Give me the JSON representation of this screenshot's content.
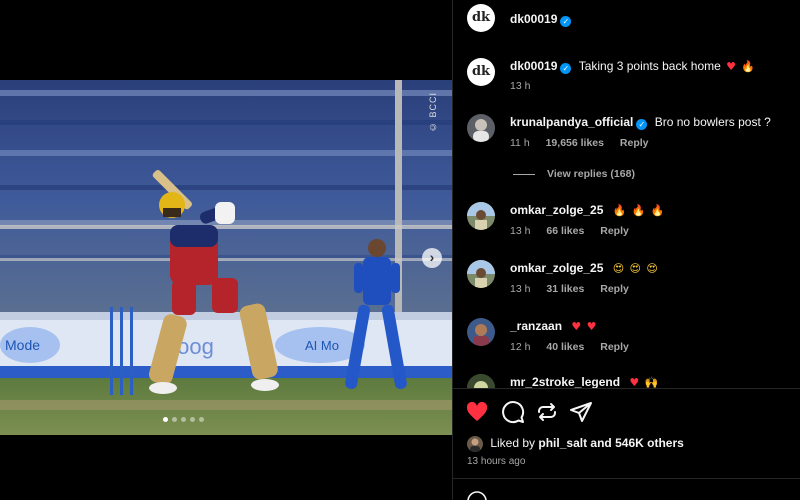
{
  "media": {
    "credit": "© BCCI",
    "carousel_dots": 5,
    "active_dot": 0
  },
  "header": {
    "username": "dk00019",
    "avatar_text": "dk"
  },
  "caption": {
    "username": "dk00019",
    "text": "Taking 3 points back home",
    "time": "13 h"
  },
  "comments": [
    {
      "username": "krunalpandya_official",
      "verified": true,
      "text": "Bro no bowlers post ?",
      "time": "11 h",
      "likes": "19,656 likes",
      "reply": "Reply"
    },
    {
      "username": "omkar_zolge_25",
      "verified": false,
      "text": "",
      "time": "13 h",
      "likes": "66 likes",
      "reply": "Reply"
    },
    {
      "username": "omkar_zolge_25",
      "verified": false,
      "text": "",
      "time": "13 h",
      "likes": "31 likes",
      "reply": "Reply"
    },
    {
      "username": "_ranzaan",
      "verified": false,
      "text": "",
      "time": "12 h",
      "likes": "40 likes",
      "reply": "Reply"
    },
    {
      "username": "mr_2stroke_legend",
      "verified": false,
      "text": "",
      "time": "",
      "likes": "",
      "reply": ""
    }
  ],
  "view_replies": "View replies (168)",
  "likes": {
    "prefix": "Liked by",
    "user": "phil_salt",
    "suffix": "and 546K others"
  },
  "time_ago": "13 hours ago",
  "colors": {
    "background": "#000000",
    "verified": "#0095f6",
    "like_red": "#ff3040",
    "muted": "#a8a8a8"
  },
  "icons": [
    "heart-icon",
    "comment-icon",
    "repost-icon",
    "share-icon",
    "verified-icon",
    "fire-emoji",
    "star-eyes-emoji",
    "red-heart-emoji",
    "raised-hands-emoji"
  ]
}
